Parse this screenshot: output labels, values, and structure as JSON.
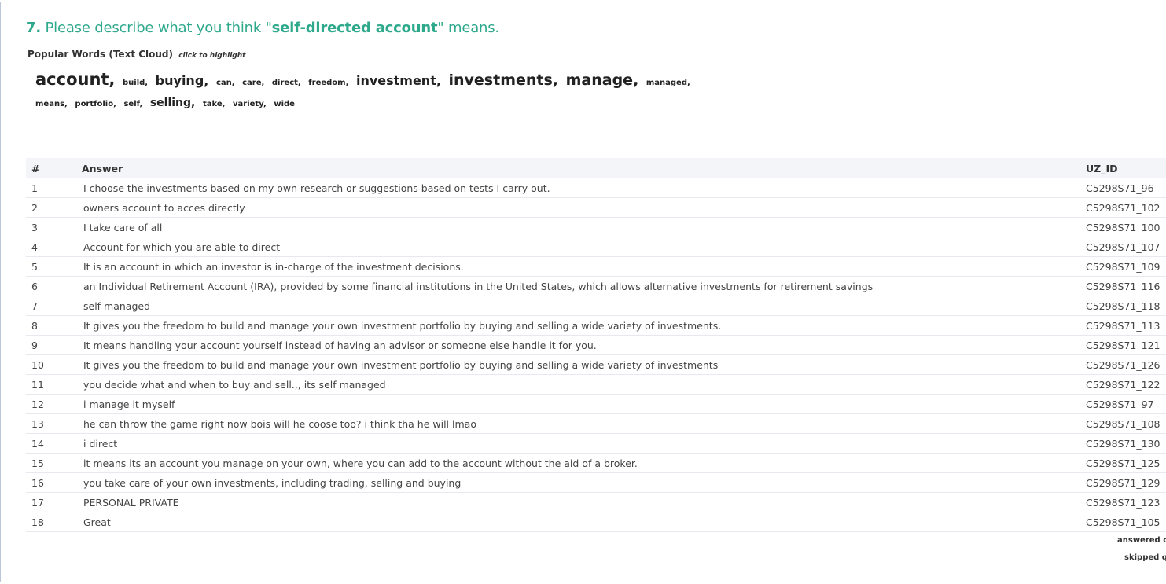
{
  "question": {
    "number": "7.",
    "text_before": " Please describe what you think \"",
    "text_bold": "self-directed account",
    "text_after": "\" means."
  },
  "popular_words": {
    "title": "Popular Words (Text Cloud)",
    "hint": "click to highlight",
    "words": [
      {
        "text": "account,",
        "size": 5
      },
      {
        "text": "build,",
        "size": 1
      },
      {
        "text": "buying,",
        "size": 3
      },
      {
        "text": "can,",
        "size": 1
      },
      {
        "text": "care,",
        "size": 1
      },
      {
        "text": "direct,",
        "size": 1
      },
      {
        "text": "freedom,",
        "size": 1
      },
      {
        "text": "investment,",
        "size": 3
      },
      {
        "text": "investments,",
        "size": 4
      },
      {
        "text": "manage,",
        "size": 4
      },
      {
        "text": "managed,",
        "size": 1
      },
      {
        "text": "means,",
        "size": 1
      },
      {
        "text": "portfolio,",
        "size": 1
      },
      {
        "text": "self,",
        "size": 1
      },
      {
        "text": "selling,",
        "size": 2
      },
      {
        "text": "take,",
        "size": 1
      },
      {
        "text": "variety,",
        "size": 1
      },
      {
        "text": "wide",
        "size": 1
      }
    ]
  },
  "table": {
    "headers": {
      "num": "#",
      "answer": "Answer",
      "id": "UZ_ID"
    },
    "rows": [
      {
        "num": "1",
        "answer": "I choose the investments based on my own research or suggestions based on tests I carry out.",
        "id": "C5298S71_96"
      },
      {
        "num": "2",
        "answer": "owners account to acces directly",
        "id": "C5298S71_102"
      },
      {
        "num": "3",
        "answer": "I take care of all",
        "id": "C5298S71_100"
      },
      {
        "num": "4",
        "answer": "Account for which you are able to direct",
        "id": "C5298S71_107"
      },
      {
        "num": "5",
        "answer": "It is an account in which an investor is in-charge of the investment decisions.",
        "id": "C5298S71_109"
      },
      {
        "num": "6",
        "answer": "an Individual Retirement Account (IRA), provided by some financial institutions in the United States, which allows alternative investments for retirement savings",
        "id": "C5298S71_116"
      },
      {
        "num": "7",
        "answer": "self managed",
        "id": "C5298S71_118"
      },
      {
        "num": "8",
        "answer": "It gives you the freedom to build and manage your own investment portfolio by buying and selling a wide variety of investments.",
        "id": "C5298S71_113"
      },
      {
        "num": "9",
        "answer": "It means handling your account yourself instead of having an advisor or someone else handle it for you.",
        "id": "C5298S71_121"
      },
      {
        "num": "10",
        "answer": "It gives you the freedom to build and manage your own investment portfolio by buying and selling a wide variety of investments",
        "id": "C5298S71_126"
      },
      {
        "num": "11",
        "answer": "you decide what and when to buy and sell.,, its self managed",
        "id": "C5298S71_122"
      },
      {
        "num": "12",
        "answer": "i manage it myself",
        "id": "C5298S71_97"
      },
      {
        "num": "13",
        "answer": "he can throw the game right now bois will he coose too? i think tha he will lmao",
        "id": "C5298S71_108"
      },
      {
        "num": "14",
        "answer": "i direct",
        "id": "C5298S71_130"
      },
      {
        "num": "15",
        "answer": "it means its an account you manage on your own, where you can add to the account without the aid of a broker.",
        "id": "C5298S71_125"
      },
      {
        "num": "16",
        "answer": "you take care of your own investments, including trading, selling and buying",
        "id": "C5298S71_129"
      },
      {
        "num": "17",
        "answer": "PERSONAL PRIVATE",
        "id": "C5298S71_123"
      },
      {
        "num": "18",
        "answer": "Great",
        "id": "C5298S71_105"
      }
    ]
  },
  "summary": {
    "answered": "answered qu",
    "skipped": "skipped qu"
  }
}
